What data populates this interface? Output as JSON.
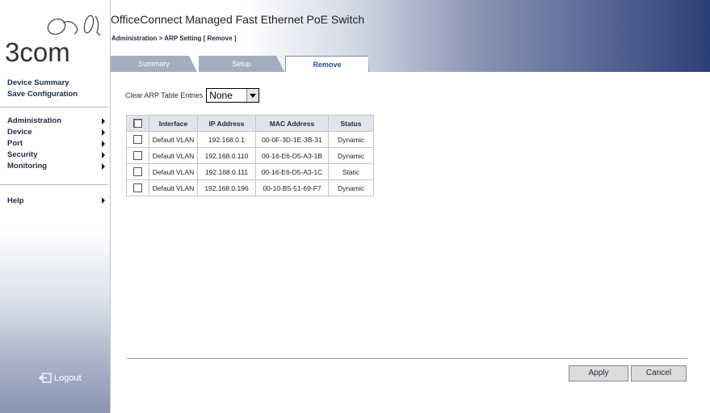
{
  "brand": {
    "logo_text": "3COM"
  },
  "header": {
    "title": "OfficeConnect Managed Fast Ethernet PoE Switch",
    "breadcrumb": "Administration > ARP Setting [ Remove ]"
  },
  "tabs": [
    {
      "label": "Summary",
      "active": false
    },
    {
      "label": "Setup",
      "active": false
    },
    {
      "label": "Remove",
      "active": true
    }
  ],
  "sidebar": {
    "links": [
      "Device Summary",
      "Save Configuration"
    ],
    "menu": [
      "Administration",
      "Device",
      "Port",
      "Security",
      "Monitoring"
    ],
    "help": "Help",
    "logout": "Logout"
  },
  "form": {
    "clear_label": "Clear ARP Table Entries",
    "clear_value": "None"
  },
  "table": {
    "headers": [
      "Interface",
      "IP Address",
      "MAC Address",
      "Status"
    ],
    "rows": [
      [
        "Default VLAN",
        "192.168.0.1",
        "00-0F-3D-1E-3B-31",
        "Dynamic"
      ],
      [
        "Default VLAN",
        "192.168.0.110",
        "00-16-E6-D5-A3-1B",
        "Dynamic"
      ],
      [
        "Default VLAN",
        "192.168.0.111",
        "00-16-E6-D5-A3-1C",
        "Static"
      ],
      [
        "Default VLAN",
        "192.168.0.196",
        "00-10-B5-51-69-F7",
        "Dynamic"
      ]
    ]
  },
  "buttons": {
    "apply": "Apply",
    "cancel": "Cancel"
  },
  "icons": {
    "menu_arrow": "triangle-right-icon",
    "logout": "logout-icon",
    "logo": "3com-logo-icon"
  }
}
